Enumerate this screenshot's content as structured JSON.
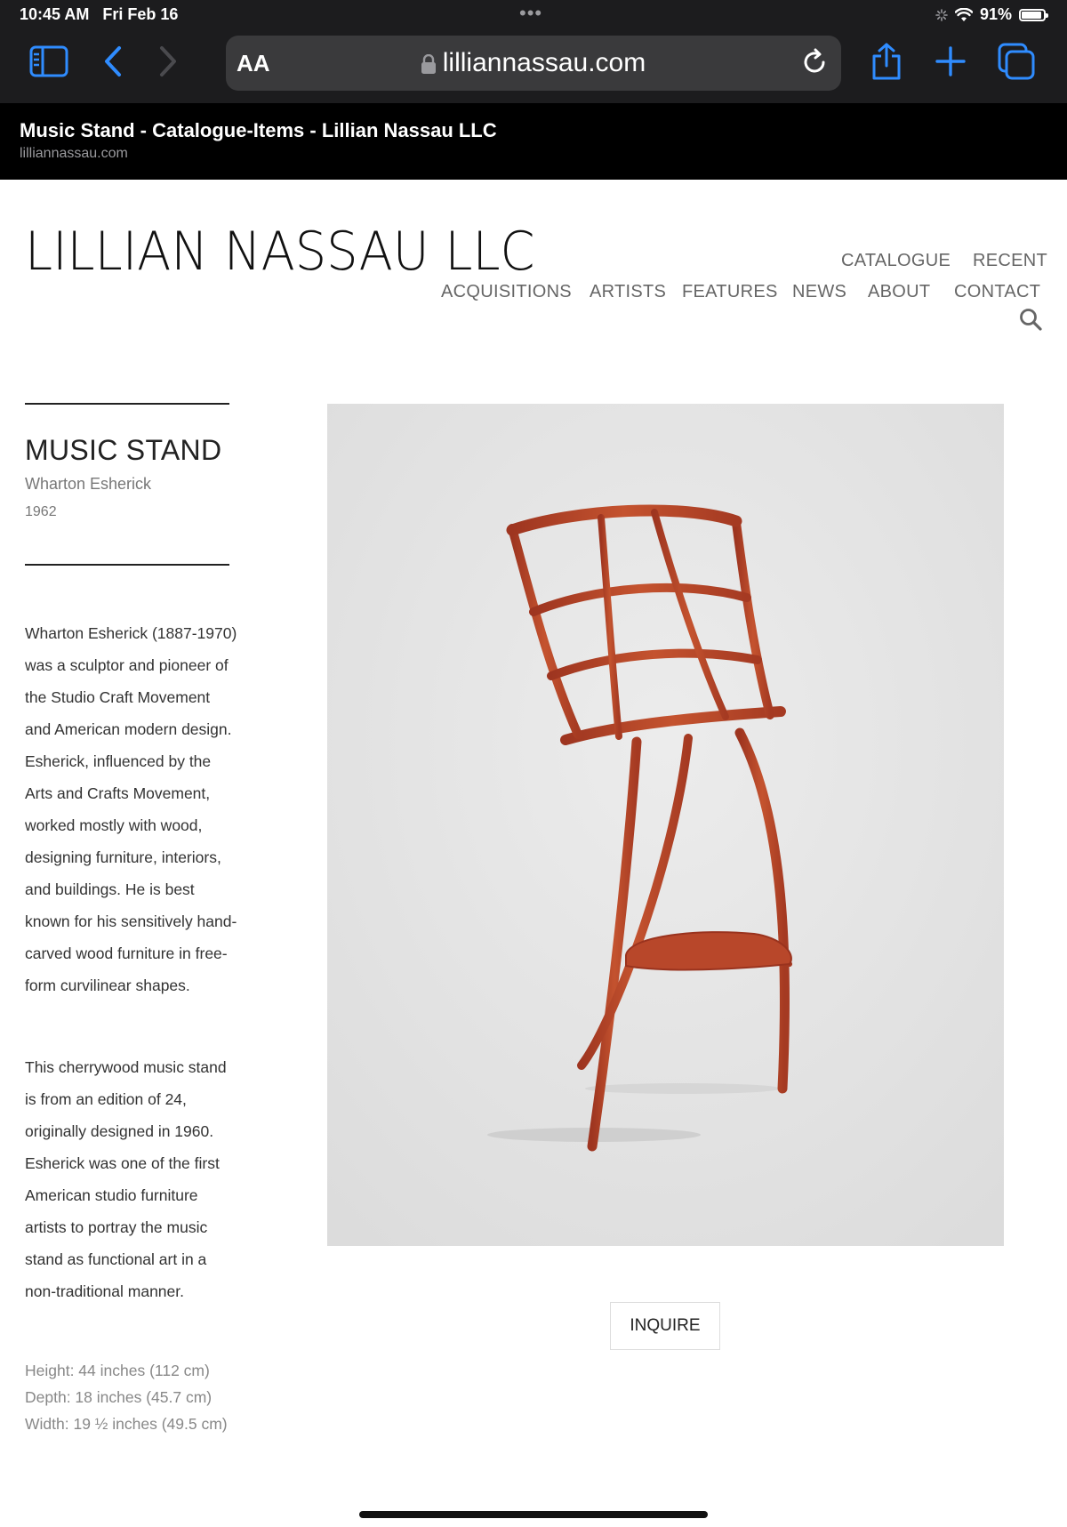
{
  "status_bar": {
    "time": "10:45 AM",
    "date": "Fri Feb 16",
    "battery": "91%",
    "battery_level": 0.91
  },
  "browser": {
    "text_size_label": "AA",
    "url": "lilliannassau.com",
    "icons": [
      "sidebar-icon",
      "back-icon",
      "forward-icon",
      "lock-icon",
      "reload-icon",
      "share-icon",
      "new-tab-icon",
      "tabs-icon"
    ],
    "tab_title": "Music Stand - Catalogue-Items - Lillian Nassau LLC",
    "tab_domain": "lilliannassau.com"
  },
  "site": {
    "logo": "LILLIAN NASSAU LLC",
    "nav": {
      "catalogue": "CATALOGUE",
      "recent": "RECENT",
      "acquisitions": "ACQUISITIONS",
      "artists": "ARTISTS",
      "features": "FEATURES",
      "news": "NEWS",
      "about": "ABOUT",
      "contact": "CONTACT"
    }
  },
  "item": {
    "title": "MUSIC STAND",
    "artist": "Wharton Esherick",
    "year": "1962",
    "description_1": "Wharton Esherick (1887-1970) was a sculptor and pioneer of the Studio Craft Movement and American modern design. Esherick, influenced by the Arts and Crafts Movement, worked mostly with wood, designing furniture, interiors, and buildings. He is best known for his sensitively hand-carved wood furniture in free-form curvilinear shapes.",
    "description_2": "This cherrywood music stand is from an edition of 24, originally designed in 1960. Esherick was one of the first American studio furniture artists to portray the music stand as functional art in a non-traditional manner.",
    "dimensions": {
      "height": "Height: 44 inches (112 cm)",
      "depth": "Depth: 18 inches (45.7 cm)",
      "width": "Width: 19 ½ inches (49.5 cm)"
    },
    "inquire_label": "INQUIRE"
  },
  "colors": {
    "browser_chrome": "#1c1c1e",
    "accent_blue": "#2f8cff",
    "wood": "#b5432a",
    "photo_background": "#e6e6e6"
  }
}
